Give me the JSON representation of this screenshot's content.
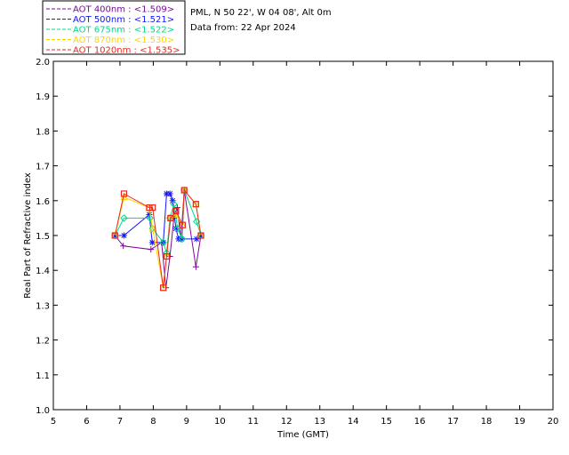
{
  "header": {
    "site": "PML, N 50 22', W 04 08', Alt 0m",
    "date_line": "Data from: 22 Apr 2024"
  },
  "chart_data": {
    "type": "line",
    "title": "",
    "xlabel": "Time (GMT)",
    "ylabel": "Real Part of Refractive index",
    "xlim": [
      5,
      20
    ],
    "ylim": [
      1.0,
      2.0
    ],
    "x_ticks": [
      "5",
      "6",
      "7",
      "8",
      "9",
      "10",
      "11",
      "12",
      "13",
      "14",
      "15",
      "16",
      "17",
      "18",
      "19",
      "20"
    ],
    "y_ticks": [
      "1.0",
      "1.1",
      "1.2",
      "1.3",
      "1.4",
      "1.5",
      "1.6",
      "1.7",
      "1.8",
      "1.9",
      "2.0"
    ],
    "grid": false,
    "legend_position": "top-left",
    "series": [
      {
        "name": "AOT  400nm : <1.509>",
        "color": "#7a0a9a",
        "marker": "plus",
        "x": [
          6.85,
          7.1,
          7.93,
          8.25,
          8.38,
          8.5,
          8.62,
          8.72,
          8.83,
          8.93,
          9.28,
          9.43
        ],
        "y": [
          1.5,
          1.47,
          1.46,
          1.48,
          1.35,
          1.44,
          1.55,
          1.58,
          1.49,
          1.63,
          1.41,
          1.5
        ]
      },
      {
        "name": "AOT  500nm : <1.521>",
        "color": "#1414ff",
        "marker": "asterisk",
        "x": [
          6.85,
          7.12,
          7.88,
          7.97,
          8.3,
          8.4,
          8.5,
          8.58,
          8.68,
          8.76,
          8.85,
          9.3,
          9.42
        ],
        "y": [
          1.5,
          1.5,
          1.56,
          1.48,
          1.48,
          1.62,
          1.62,
          1.6,
          1.52,
          1.49,
          1.49,
          1.49,
          1.5
        ]
      },
      {
        "name": "AOT  675nm : <1.522>",
        "color": "#00d98a",
        "marker": "diamond",
        "x": [
          6.85,
          7.12,
          7.9,
          7.98,
          8.3,
          8.4,
          8.5,
          8.62,
          8.73,
          8.87,
          8.93,
          9.3,
          9.43
        ],
        "y": [
          1.5,
          1.55,
          1.55,
          1.52,
          1.48,
          1.45,
          1.55,
          1.59,
          1.52,
          1.49,
          1.63,
          1.54,
          1.5
        ]
      },
      {
        "name": "AOT  870nm : <1.530>",
        "color": "#ffd400",
        "marker": "triangle",
        "x": [
          6.85,
          7.12,
          7.88,
          7.98,
          8.3,
          8.4,
          8.52,
          8.68,
          8.88,
          8.93,
          9.28,
          9.43
        ],
        "y": [
          1.5,
          1.61,
          1.58,
          1.52,
          1.35,
          1.44,
          1.55,
          1.56,
          1.53,
          1.63,
          1.59,
          1.5
        ]
      },
      {
        "name": "AOT 1020nm : <1.535>",
        "color": "#e8281e",
        "marker": "square",
        "x": [
          6.85,
          7.12,
          7.88,
          7.98,
          8.3,
          8.4,
          8.52,
          8.68,
          8.88,
          8.93,
          9.28,
          9.43
        ],
        "y": [
          1.5,
          1.62,
          1.58,
          1.58,
          1.35,
          1.44,
          1.55,
          1.57,
          1.53,
          1.63,
          1.59,
          1.5
        ]
      }
    ]
  }
}
